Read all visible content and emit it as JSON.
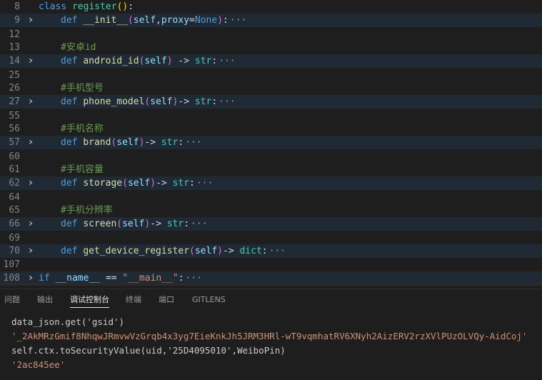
{
  "editor": {
    "lines": [
      {
        "num": "8",
        "fold": false,
        "hl": false,
        "kind": "class",
        "kw": "class",
        "name": "register",
        "p1": "(",
        "p2": ")",
        "colon": ":"
      },
      {
        "num": "9",
        "fold": true,
        "hl": true,
        "kind": "def",
        "kw": "def",
        "name": "__init__",
        "args": "(self,proxy=None)",
        "arg_self": "self",
        "arg_proxy": "proxy",
        "arg_none": "None",
        "tail": ":",
        "ell": "···"
      },
      {
        "num": "12",
        "fold": false,
        "hl": false,
        "kind": "blank"
      },
      {
        "num": "13",
        "fold": false,
        "hl": false,
        "kind": "comment",
        "text": "#安卓id"
      },
      {
        "num": "14",
        "fold": true,
        "hl": true,
        "kind": "def2",
        "kw": "def",
        "name": "android_id",
        "self": "self",
        "arrow": " -> ",
        "ret": "str",
        "ell": "···"
      },
      {
        "num": "25",
        "fold": false,
        "hl": false,
        "kind": "blank"
      },
      {
        "num": "26",
        "fold": false,
        "hl": false,
        "kind": "comment",
        "text": "#手机型号"
      },
      {
        "num": "27",
        "fold": true,
        "hl": true,
        "kind": "def2",
        "kw": "def",
        "name": "phone_model",
        "self": "self",
        "arrow": "-> ",
        "ret": "str",
        "ell": "···"
      },
      {
        "num": "55",
        "fold": false,
        "hl": false,
        "kind": "blank"
      },
      {
        "num": "56",
        "fold": false,
        "hl": false,
        "kind": "comment",
        "text": "#手机名称"
      },
      {
        "num": "57",
        "fold": true,
        "hl": true,
        "kind": "def2",
        "kw": "def",
        "name": "brand",
        "self": "self",
        "arrow": "-> ",
        "ret": "str",
        "ell": "···"
      },
      {
        "num": "60",
        "fold": false,
        "hl": false,
        "kind": "blank"
      },
      {
        "num": "61",
        "fold": false,
        "hl": false,
        "kind": "comment",
        "text": "#手机容量"
      },
      {
        "num": "62",
        "fold": true,
        "hl": true,
        "kind": "def2",
        "kw": "def",
        "name": "storage",
        "self": "self",
        "arrow": "-> ",
        "ret": "str",
        "ell": "···"
      },
      {
        "num": "64",
        "fold": false,
        "hl": false,
        "kind": "blank"
      },
      {
        "num": "65",
        "fold": false,
        "hl": false,
        "kind": "comment",
        "text": "#手机分辨率"
      },
      {
        "num": "66",
        "fold": true,
        "hl": true,
        "kind": "def2",
        "kw": "def",
        "name": "screen",
        "self": "self",
        "arrow": "-> ",
        "ret": "str",
        "ell": "···"
      },
      {
        "num": "69",
        "fold": false,
        "hl": false,
        "kind": "blank"
      },
      {
        "num": "70",
        "fold": true,
        "hl": true,
        "kind": "def2",
        "kw": "def",
        "name": "get_device_register",
        "self": "self",
        "arrow": "-> ",
        "ret": "dict",
        "ell": "···"
      },
      {
        "num": "107",
        "fold": false,
        "hl": false,
        "kind": "blank"
      },
      {
        "num": "108",
        "fold": true,
        "hl": true,
        "kind": "ifmain",
        "kw": "if",
        "lhs": "__name__",
        "op": "==",
        "rhs": "\"__main__\"",
        "tail": ":",
        "ell": "···"
      }
    ]
  },
  "panel": {
    "tabs": [
      {
        "label": "问题",
        "active": false
      },
      {
        "label": "输出",
        "active": false
      },
      {
        "label": "调试控制台",
        "active": true
      },
      {
        "label": "终端",
        "active": false
      },
      {
        "label": "端口",
        "active": false
      },
      {
        "label": "GITLENS",
        "active": false
      }
    ],
    "console": [
      {
        "type": "in",
        "text": "data_json.get('gsid')"
      },
      {
        "type": "out",
        "text": "'_2AkMRzGmif8NhqwJRmvwVzGrqb4x3yg7EieKnkJh5JRM3HRl-wT9vqmhatRV6XNyh2AizERV2rzXVlPUzOLVQy-AidCoj'"
      },
      {
        "type": "in",
        "text": "self.ctx.toSecurityValue(uid,'25D4095010',WeiboPin)"
      },
      {
        "type": "out",
        "text": "'2ac845ee'"
      }
    ]
  }
}
